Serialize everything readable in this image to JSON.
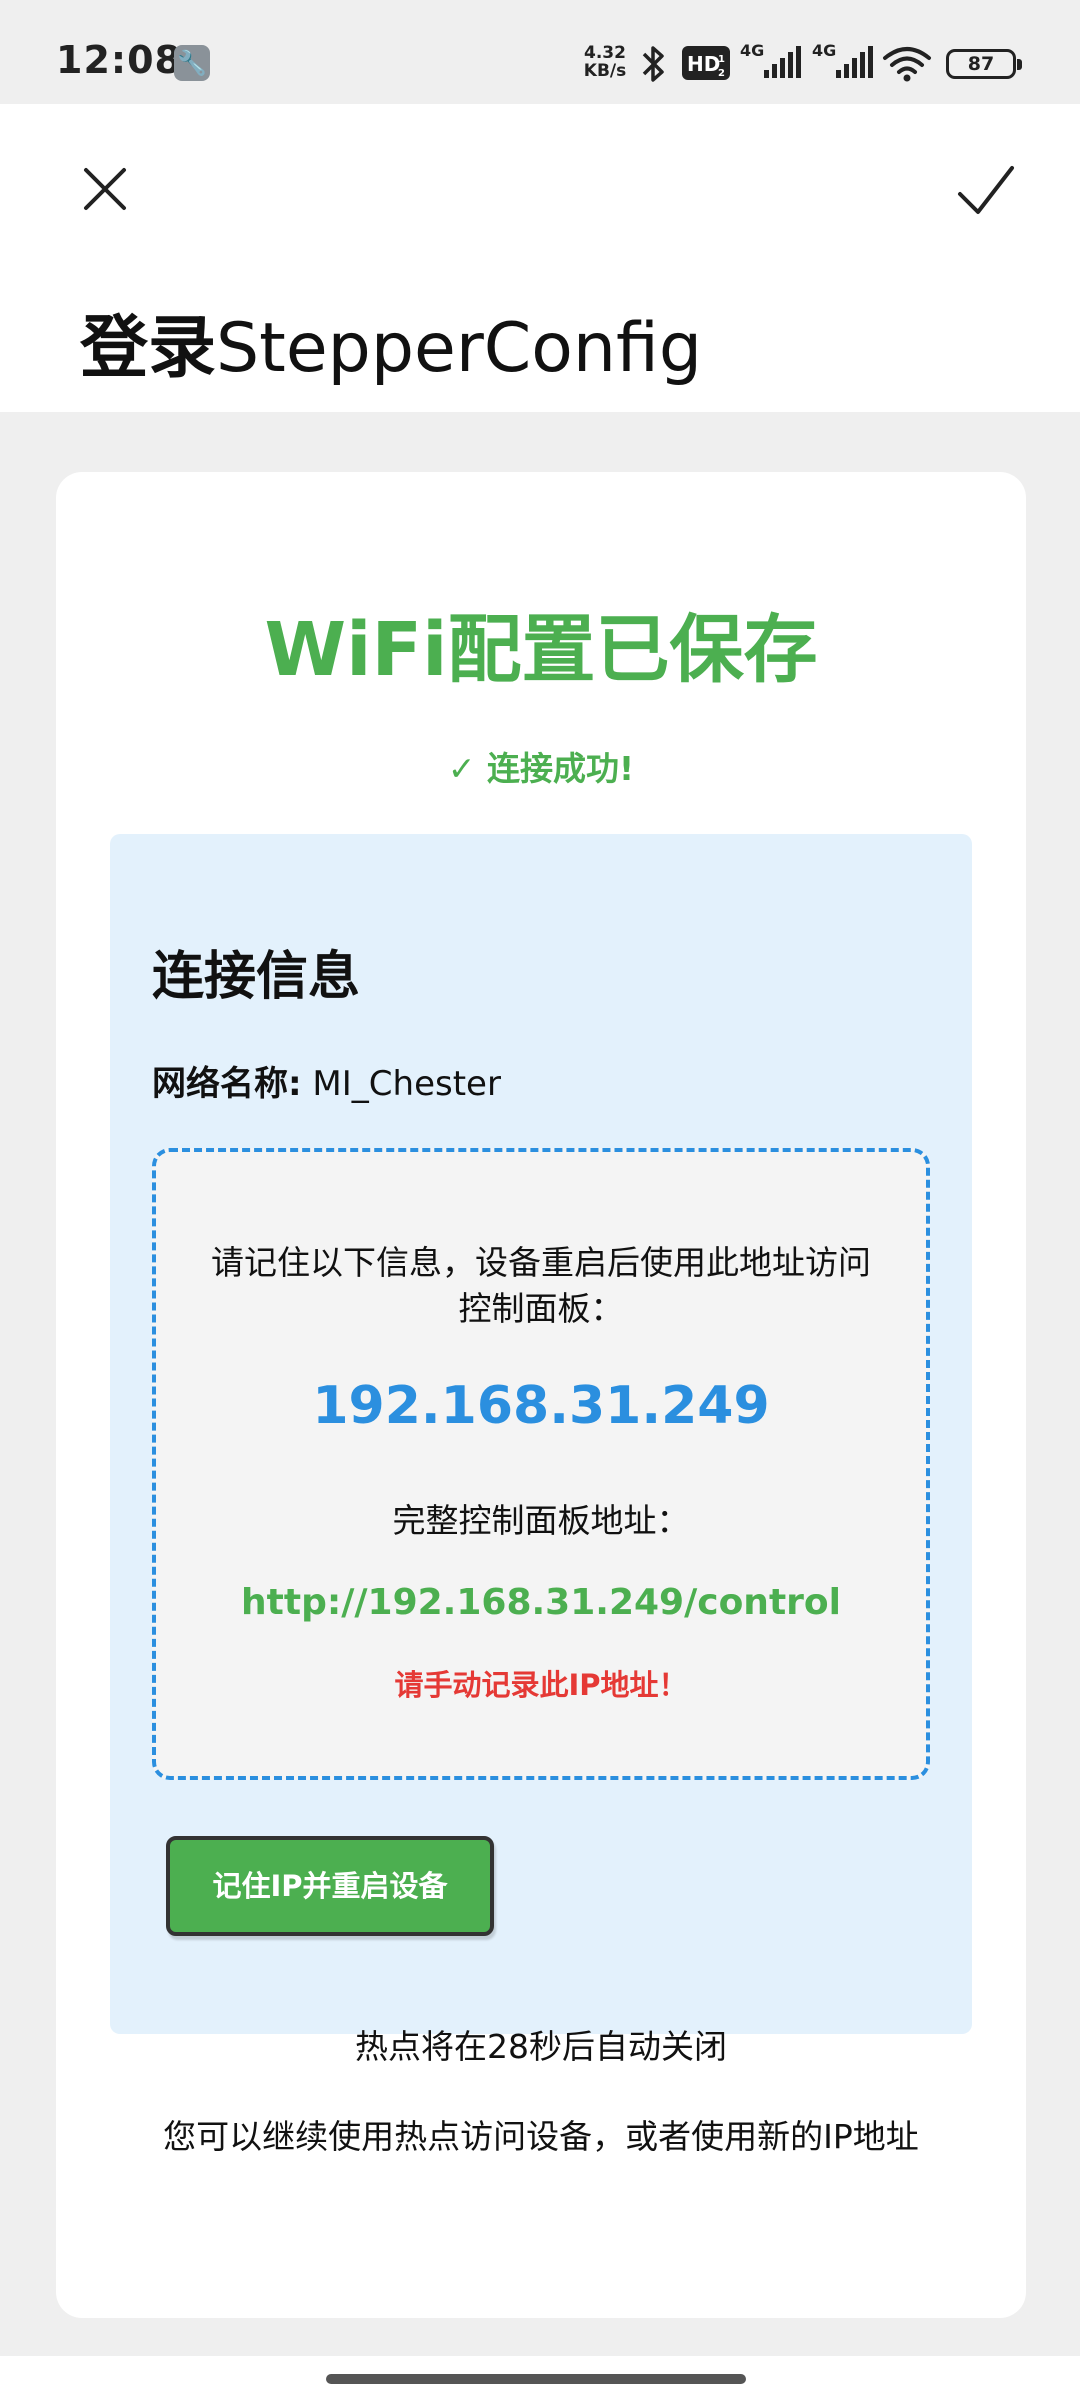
{
  "status_bar": {
    "time": "12:08",
    "speed_value": "4.32",
    "speed_unit": "KB/s",
    "hd_label": "HD",
    "network_1": "4G",
    "network_2": "4G",
    "battery": "87"
  },
  "header": {
    "title_cn": "登录",
    "title_en": "StepperConfig"
  },
  "card": {
    "title": "WiFi配置已保存",
    "success": "✓ 连接成功!",
    "info": {
      "heading": "连接信息",
      "ssid_label": "网络名称:",
      "ssid_value": " MI_Chester",
      "note": "请记住以下信息，设备重启后使用此地址访问控制面板：",
      "ip": "192.168.31.249",
      "full_label": "完整控制面板地址：",
      "full_url": "http://192.168.31.249/control",
      "warning": "请手动记录此IP地址！",
      "button": "记住IP并重启设备"
    },
    "hotspot_note": "热点将在28秒后自动关闭",
    "hotspot_hint": "您可以继续使用热点访问设备，或者使用新的IP地址"
  }
}
